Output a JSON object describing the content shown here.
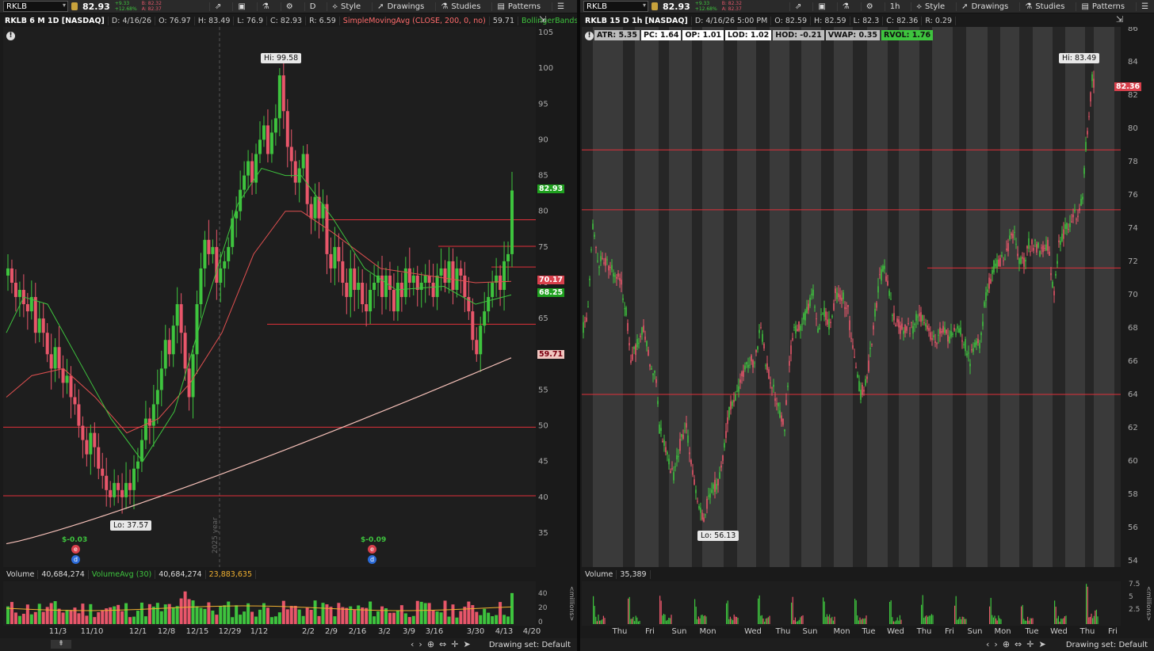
{
  "left": {
    "symbol": "RKLB",
    "last": "82.93",
    "change_abs": "+9.33",
    "change_pct": "+12.68%",
    "bid": "B: 82.32",
    "ask": "A: 82.37",
    "aggregation": "D",
    "toolbar": {
      "style": "Style",
      "drawings": "Drawings",
      "studies": "Studies",
      "patterns": "Patterns"
    },
    "info": {
      "title": "RKLB 6 M 1D [NASDAQ]",
      "date": "D: 4/16/26",
      "open": "O: 76.97",
      "high": "H: 83.49",
      "low": "L: 76.9",
      "close": "C: 82.93",
      "range": "R: 6.59",
      "sma": "SimpleMovingAvg (CLOSE, 200, 0, no)",
      "sma_val": "59.71",
      "bb": "BollingerBands ..."
    },
    "hi_label": "Hi: 99.58",
    "lo_label": "Lo: 37.57",
    "price_tags": [
      "82.93",
      "70.17",
      "68.25",
      "59.71"
    ],
    "price_ticks": [
      "105",
      "100",
      "95",
      "90",
      "85",
      "80",
      "75",
      "70",
      "65",
      "60",
      "55",
      "50",
      "45",
      "40",
      "35"
    ],
    "year_label": "2025 year",
    "earnings": [
      "$-0.03",
      "$-0.09"
    ],
    "volume": {
      "label": "Volume",
      "value": "40,684,274",
      "avg_label": "VolumeAvg (30)",
      "avg_value": "40,684,274",
      "avg2": "23,883,635",
      "ticks": [
        "40",
        "20",
        "0"
      ],
      "unit": "<millions>"
    },
    "dates": [
      "11/3",
      "11/10",
      "12/1",
      "12/8",
      "12/15",
      "12/29",
      "1/12",
      "2/2",
      "2/9",
      "2/16",
      "3/2",
      "3/9",
      "3/16",
      "3/30",
      "4/13",
      "4/20"
    ],
    "drawing_set": "Drawing set: Default"
  },
  "right": {
    "symbol": "RKLB",
    "last": "82.93",
    "change_abs": "+9.33",
    "change_pct": "+12.68%",
    "bid": "B: 82.32",
    "ask": "A: 82.37",
    "aggregation": "1h",
    "toolbar": {
      "style": "Style",
      "drawings": "Drawings",
      "studies": "Studies",
      "patterns": "Patterns"
    },
    "info": {
      "title": "RKLB 15 D 1h [NASDAQ]",
      "date": "D: 4/16/26 5:00 PM",
      "open": "O: 82.59",
      "high": "H: 82.59",
      "low": "L: 82.3",
      "close": "C: 82.36",
      "range": "R: 0.29"
    },
    "metrics": [
      {
        "label": "ATR: 5.35",
        "bg": "#bdbdbd",
        "fg": "#111"
      },
      {
        "label": "PC: 1.64",
        "bg": "#ffffff",
        "fg": "#111"
      },
      {
        "label": "OP: 1.01",
        "bg": "#ffffff",
        "fg": "#111"
      },
      {
        "label": "LOD: 1.02",
        "bg": "#ffffff",
        "fg": "#111"
      },
      {
        "label": "HOD: -0.21",
        "bg": "#bdbdbd",
        "fg": "#111"
      },
      {
        "label": "VWAP: 0.35",
        "bg": "#bdbdbd",
        "fg": "#111"
      },
      {
        "label": "RVOL: 1.76",
        "bg": "#3ec43e",
        "fg": "#111"
      }
    ],
    "hi_label": "Hi: 83.49",
    "lo_label": "Lo: 56.13",
    "price_tag": "82.36",
    "price_ticks": [
      "86",
      "84",
      "82",
      "80",
      "78",
      "76",
      "74",
      "72",
      "70",
      "68",
      "66",
      "64",
      "62",
      "60",
      "58",
      "56",
      "54"
    ],
    "volume": {
      "label": "Volume",
      "value": "35,389",
      "ticks": [
        "7.5",
        "5",
        "2.5"
      ],
      "unit": "<millions>"
    },
    "days": [
      "Thu",
      "Fri",
      "Sun",
      "Mon",
      "Wed",
      "Thu",
      "Sun",
      "Mon",
      "Tue",
      "Wed",
      "Thu",
      "Fri",
      "Sun",
      "Mon",
      "Tue",
      "Wed",
      "Thu",
      "Fri"
    ],
    "drawing_set": "Drawing set: Default"
  },
  "colors": {
    "up": "#3ec43e",
    "down": "#e8566a",
    "hline": "#e0303a",
    "sma200": "#f5c0b8",
    "ma_red": "#e05050",
    "ma_green": "#3ec43e"
  }
}
